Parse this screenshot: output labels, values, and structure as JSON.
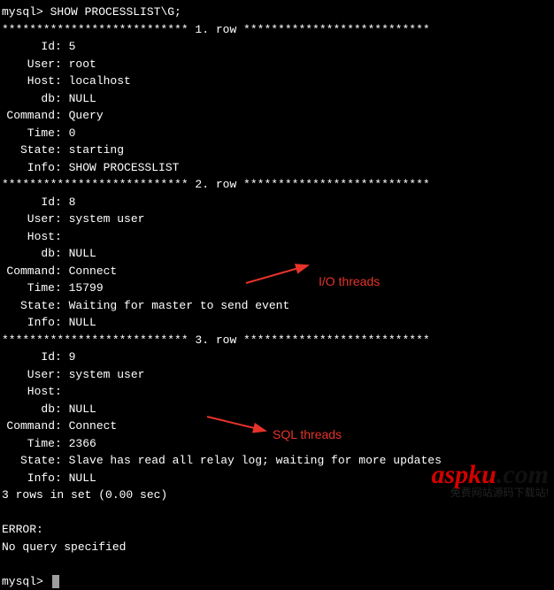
{
  "terminal": {
    "prompt": "mysql>",
    "command": "SHOW PROCESSLIST\\G;",
    "row_headers": {
      "r1": "*************************** 1. row ***************************",
      "r2": "*************************** 2. row ***************************",
      "r3": "*************************** 3. row ***************************"
    },
    "labels": {
      "id": "Id",
      "user": "User",
      "host": "Host",
      "db": "db",
      "command": "Command",
      "time": "Time",
      "state": "State",
      "info": "Info"
    },
    "rows": [
      {
        "id": "5",
        "user": "root",
        "host": "localhost",
        "db": "NULL",
        "command": "Query",
        "time": "0",
        "state": "starting",
        "info": "SHOW PROCESSLIST"
      },
      {
        "id": "8",
        "user": "system user",
        "host": "",
        "db": "NULL",
        "command": "Connect",
        "time": "15799",
        "state": "Waiting for master to send event",
        "info": "NULL"
      },
      {
        "id": "9",
        "user": "system user",
        "host": "",
        "db": "NULL",
        "command": "Connect",
        "time": "2366",
        "state": "Slave has read all relay log; waiting for more updates",
        "info": "NULL"
      }
    ],
    "summary": "3 rows in set (0.00 sec)",
    "error": {
      "label": "ERROR:",
      "message": "No query specified"
    }
  },
  "annotations": {
    "io_threads": "I/O threads",
    "sql_threads": "SQL threads"
  },
  "watermark": {
    "brand_main": "aspku",
    "brand_suffix": ".com",
    "tagline": "免费网站源码下载站!"
  }
}
